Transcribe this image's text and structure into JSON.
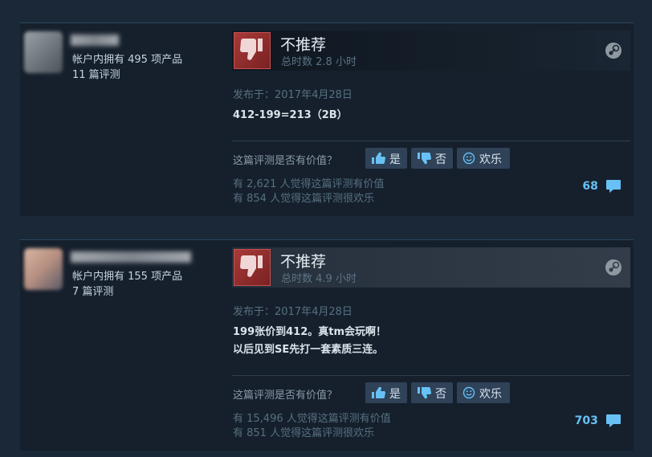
{
  "helpful_question": "这篇评测是否有价值？",
  "buttons": {
    "yes": "是",
    "no": "否",
    "funny": "欢乐"
  },
  "reviews": [
    {
      "products_owned": "帐户内拥有 495 项产品",
      "review_count": "11 篇评测",
      "verdict": "不推荐",
      "hours": "总时数 2.8 小时",
      "posted": "发布于：2017年4月28日",
      "content_lines": [
        "412-199=213（2B）"
      ],
      "helpful_text": "有 2,621 人觉得这篇评测有价值",
      "funny_text": "有 854 人觉得这篇评测很欢乐",
      "comment_count": "68"
    },
    {
      "products_owned": "帐户内拥有 155 项产品",
      "review_count": "7 篇评测",
      "verdict": "不推荐",
      "hours": "总时数 4.9 小时",
      "posted": "发布于：2017年4月28日",
      "content_lines": [
        "199张价到412。真tm会玩啊！",
        "以后见到SE先打一套素质三连。"
      ],
      "helpful_text": "有 15,496 人觉得这篇评测有价值",
      "funny_text": "有 851 人觉得这篇评测很欢乐",
      "comment_count": "703"
    }
  ],
  "icons": {
    "thumb_down": "thumbs-down-icon",
    "thumb_up_small": "thumbs-up-icon",
    "funny": "smiley-icon",
    "comment": "comment-bubble-icon",
    "platform": "steam-icon"
  },
  "colors": {
    "background": "#1b2838",
    "card": "#16202d",
    "thumb_down": "#a83a3a",
    "link": "#67c1f5",
    "button": "#2f4258"
  }
}
